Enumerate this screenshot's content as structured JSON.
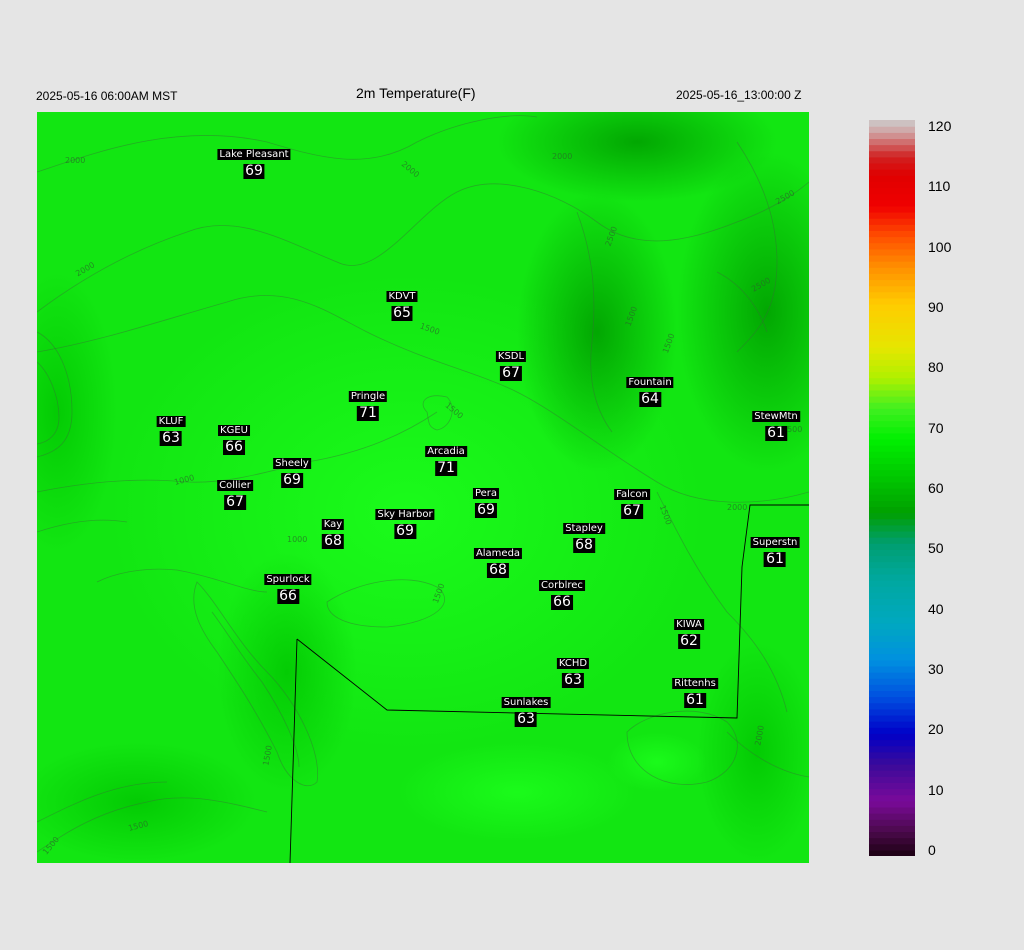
{
  "header": {
    "local_time": "2025-05-16 06:00AM MST",
    "title": "2m Temperature(F)",
    "utc_time": "2025-05-16_13:00:00 Z"
  },
  "map": {
    "field": "2m Temperature",
    "units": "F",
    "background_color": "#12e612",
    "stations": [
      {
        "name": "Lake Pleasant",
        "value": "69"
      },
      {
        "name": "KDVT",
        "value": "65"
      },
      {
        "name": "KSDL",
        "value": "67"
      },
      {
        "name": "Fountain",
        "value": "64"
      },
      {
        "name": "Pringle",
        "value": "71"
      },
      {
        "name": "StewMtn",
        "value": "61"
      },
      {
        "name": "KLUF",
        "value": "63"
      },
      {
        "name": "KGEU",
        "value": "66"
      },
      {
        "name": "Arcadia",
        "value": "71"
      },
      {
        "name": "Sheely",
        "value": "69"
      },
      {
        "name": "Collier",
        "value": "67"
      },
      {
        "name": "Pera",
        "value": "69"
      },
      {
        "name": "Falcon",
        "value": "67"
      },
      {
        "name": "Kay",
        "value": "68"
      },
      {
        "name": "Sky Harbor",
        "value": "69"
      },
      {
        "name": "Stapley",
        "value": "68"
      },
      {
        "name": "Superstn",
        "value": "61"
      },
      {
        "name": "Alameda",
        "value": "68"
      },
      {
        "name": "Spurlock",
        "value": "66"
      },
      {
        "name": "Corblrec",
        "value": "66"
      },
      {
        "name": "KIWA",
        "value": "62"
      },
      {
        "name": "KCHD",
        "value": "63"
      },
      {
        "name": "Rittenhs",
        "value": "61"
      },
      {
        "name": "Sunlakes",
        "value": "63"
      }
    ],
    "contour_labels": [
      "2000",
      "2000",
      "2000",
      "2500",
      "2500",
      "2000",
      "1500",
      "2500",
      "1500",
      "1500",
      "1000",
      "2000",
      "1500",
      "1500",
      "1500",
      "1000",
      "1500",
      "1500",
      "2000",
      "1500",
      "1500"
    ]
  },
  "colorbar": {
    "min": 0,
    "max": 120,
    "tick_labels": [
      "120",
      "110",
      "100",
      "90",
      "80",
      "70",
      "60",
      "50",
      "40",
      "30",
      "20",
      "10",
      "0"
    ],
    "stops": [
      {
        "value": 0,
        "color": "#1a0010"
      },
      {
        "value": 4,
        "color": "#4a0a4a"
      },
      {
        "value": 9,
        "color": "#7a0a9a"
      },
      {
        "value": 15,
        "color": "#3a0a9a"
      },
      {
        "value": 20,
        "color": "#0000c8"
      },
      {
        "value": 26,
        "color": "#0050e0"
      },
      {
        "value": 32,
        "color": "#0090e0"
      },
      {
        "value": 38,
        "color": "#00a8c0"
      },
      {
        "value": 45,
        "color": "#00a8a0"
      },
      {
        "value": 51,
        "color": "#009e70"
      },
      {
        "value": 56,
        "color": "#00a000"
      },
      {
        "value": 62,
        "color": "#00c800"
      },
      {
        "value": 68,
        "color": "#00f000"
      },
      {
        "value": 73,
        "color": "#40f020"
      },
      {
        "value": 78,
        "color": "#b0f000"
      },
      {
        "value": 83,
        "color": "#e6e600"
      },
      {
        "value": 90,
        "color": "#ffcc00"
      },
      {
        "value": 96,
        "color": "#ff9000"
      },
      {
        "value": 101,
        "color": "#ff5000"
      },
      {
        "value": 106,
        "color": "#f00000"
      },
      {
        "value": 111,
        "color": "#e00000"
      },
      {
        "value": 114,
        "color": "#d02020"
      },
      {
        "value": 116,
        "color": "#d06060"
      },
      {
        "value": 118,
        "color": "#d0a0a0"
      },
      {
        "value": 120,
        "color": "#cccccc"
      }
    ]
  }
}
